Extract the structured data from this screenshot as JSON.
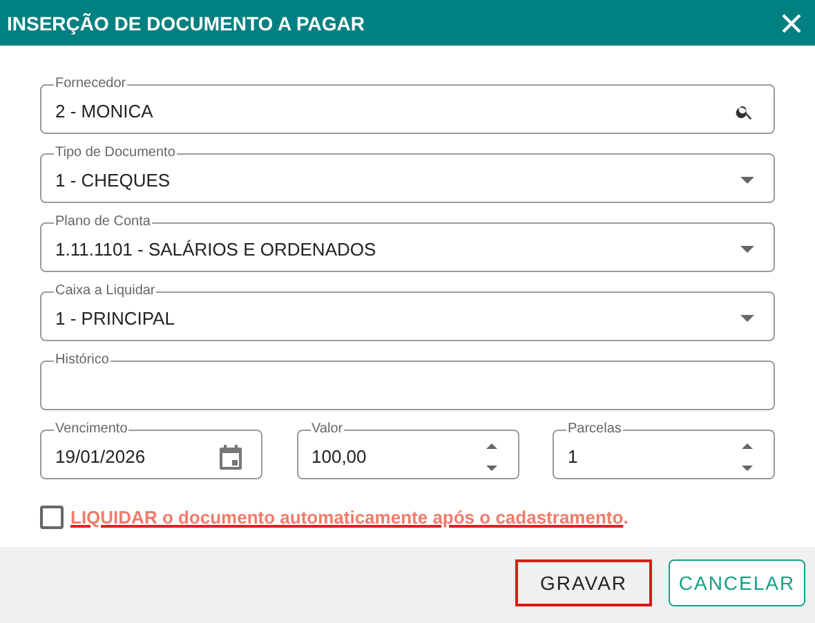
{
  "window": {
    "title": "INSERÇÃO DE DOCUMENTO A PAGAR"
  },
  "fields": [
    {
      "kind": "search",
      "label": "Fornecedor",
      "value": "2 - MONICA"
    },
    {
      "kind": "select",
      "label": "Tipo de Documento",
      "value": "1 - CHEQUES"
    },
    {
      "kind": "select",
      "label": "Plano de Conta",
      "value": "1.11.1101 - SALÁRIOS E ORDENADOS"
    },
    {
      "kind": "select",
      "label": "Caixa a Liquidar",
      "value": "1 - PRINCIPAL"
    },
    {
      "kind": "text",
      "label": "Histórico"
    }
  ],
  "row_fields": [
    {
      "kind": "date",
      "label": "Vencimento",
      "value": "19/01/2026"
    },
    {
      "kind": "number",
      "label": "Valor",
      "value": "100,00"
    },
    {
      "kind": "number",
      "label": "Parcelas",
      "value": "1"
    }
  ],
  "auto_settle": {
    "checked": false,
    "link": "LIQUIDAR o documento automaticamente após o cadastramento",
    "suffix": "."
  },
  "buttons": [
    {
      "label": "GRAVAR",
      "kind": "plain",
      "highlighted": true
    },
    {
      "label": "CANCELAR",
      "kind": "outline",
      "highlighted": false
    }
  ]
}
